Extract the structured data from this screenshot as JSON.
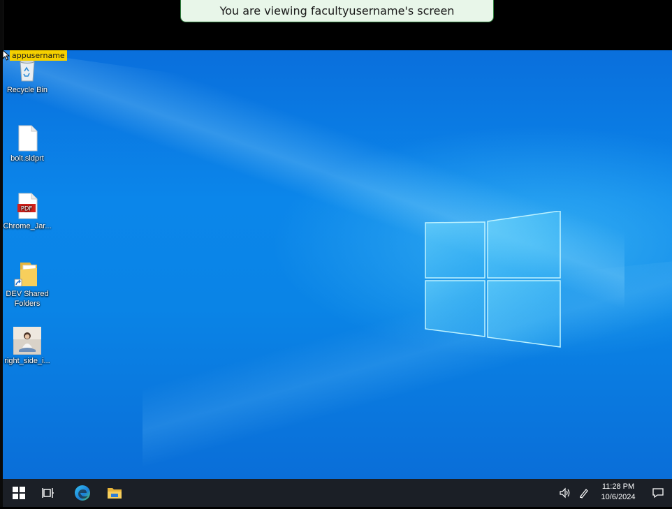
{
  "banner": {
    "text": "You are viewing facultyusername's screen"
  },
  "cursor_tag": {
    "text": "appusername"
  },
  "desktop_icons": [
    {
      "label": "Recycle Bin",
      "icon": "recycle-bin-icon"
    },
    {
      "label": "bolt.sldprt",
      "icon": "blank-file-icon"
    },
    {
      "label": "Chrome_Jar...",
      "icon": "pdf-file-icon",
      "badge": "PDF"
    },
    {
      "label": "DEV Shared Folders",
      "icon": "shortcut-folder-icon"
    },
    {
      "label": "right_side_i...",
      "icon": "image-thumbnail-icon"
    }
  ],
  "taskbar": {
    "time": "11:28 PM",
    "date": "10/6/2024",
    "buttons": [
      "windows-start-icon",
      "task-view-icon",
      "edge-browser-icon",
      "file-explorer-icon"
    ],
    "tray": [
      "volume-icon",
      "pen-icon",
      "notifications-icon"
    ]
  },
  "colors": {
    "banner_bg": "#e8f6e9",
    "banner_border": "#2f7f3e",
    "tag_bg": "#f5d000",
    "taskbar_bg": "#1b1f26",
    "desktop_blue": "#0a84e6"
  }
}
